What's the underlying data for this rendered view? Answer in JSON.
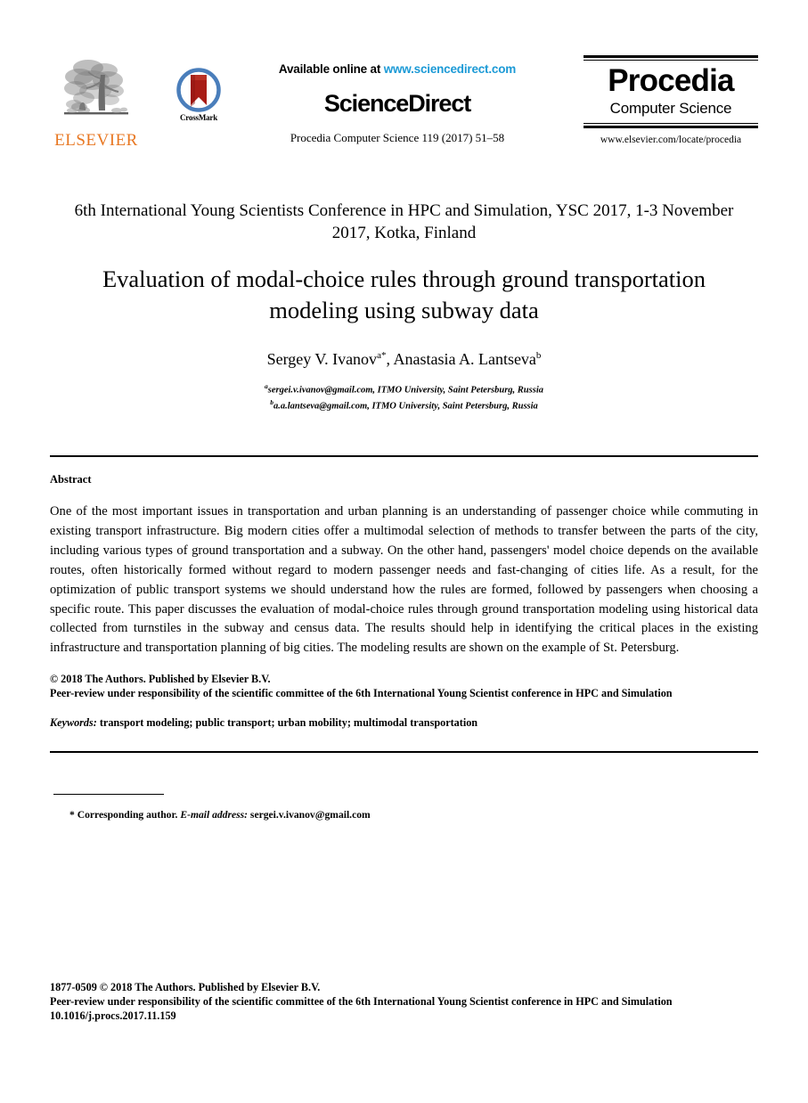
{
  "masthead": {
    "elsevier_logo_word": "ELSEVIER",
    "crossmark_label": "CrossMark",
    "available_online_prefix": "Available online at ",
    "available_online_url": "www.sciencedirect.com",
    "sciencedirect_logo": "ScienceDirect",
    "journal_citation": "Procedia Computer Science 119 (2017) 51–58",
    "procedia_title": "Procedia",
    "procedia_subtitle": "Computer Science",
    "procedia_url": "www.elsevier.com/locate/procedia"
  },
  "conference": {
    "line": "6th International Young Scientists Conference in HPC and Simulation, YSC 2017, 1-3 November 2017, Kotka, Finland"
  },
  "article": {
    "title": "Evaluation of modal-choice rules through ground transportation modeling using subway data",
    "authors_html": "Sergey V. Ivanov<sup>a</sup><sup>*</sup>, Anastasia A. Lantseva<sup>b</sup>",
    "author_1_name": "Sergey V. Ivanov",
    "author_1_marks": "a*",
    "author_2_name": "Anastasia A. Lantseva",
    "author_2_marks": "b",
    "affiliation_1": "sergei.v.ivanov@gmail.com, ITMO University, Saint Petersburg, Russia",
    "affiliation_1_mark": "a",
    "affiliation_2": "a.a.lantseva@gmail.com, ITMO University, Saint Petersburg, Russia",
    "affiliation_2_mark": "b"
  },
  "abstract": {
    "heading": "Abstract",
    "body": "One of the most important issues in transportation and urban planning is an understanding of passenger choice while commuting in existing transport infrastructure. Big modern cities offer a multimodal selection of methods to transfer between the parts of the city, including various types of ground transportation and a subway. On the other hand, passengers' model choice depends on the available routes, often historically formed without regard to modern passenger needs and fast-changing of cities life. As a result, for the optimization of public transport systems we should understand how the rules are formed, followed by passengers when choosing a specific route. This paper discusses the evaluation of modal-choice rules through ground transportation modeling using historical data collected from turnstiles in the subway and census data. The results should help in identifying the critical places in the existing infrastructure and transportation planning of big cities. The modeling results are shown on the example of St. Petersburg.",
    "copyright_line": "© 2018 The Authors. Published by Elsevier B.V.",
    "peer_review_line": "Peer-review under responsibility of the scientific committee of the 6th International Young Scientist conference in HPC and Simulation",
    "keywords_label": "Keywords:",
    "keywords_value": " transport modeling; public transport; urban mobility; multimodal transportation"
  },
  "footnote": {
    "marker": "*",
    "corresponding_text": " Corresponding author. ",
    "email_label": "E-mail address:",
    "email_value": " sergei.v.ivanov@gmail.com"
  },
  "page_footer": {
    "issn_line": "1877-0509 © 2018 The Authors. Published by Elsevier B.V.",
    "peer_review_line": "Peer-review under responsibility of the scientific committee of the 6th International Young Scientist conference in HPC and Simulation",
    "doi_line": "10.1016/j.procs.2017.11.159"
  },
  "colors": {
    "elsevier_orange": "#E87722",
    "sciencedirect_link_blue": "#1C9AD6",
    "crossmark_blue": "#4A7EBB",
    "crossmark_red": "#A81C16"
  }
}
